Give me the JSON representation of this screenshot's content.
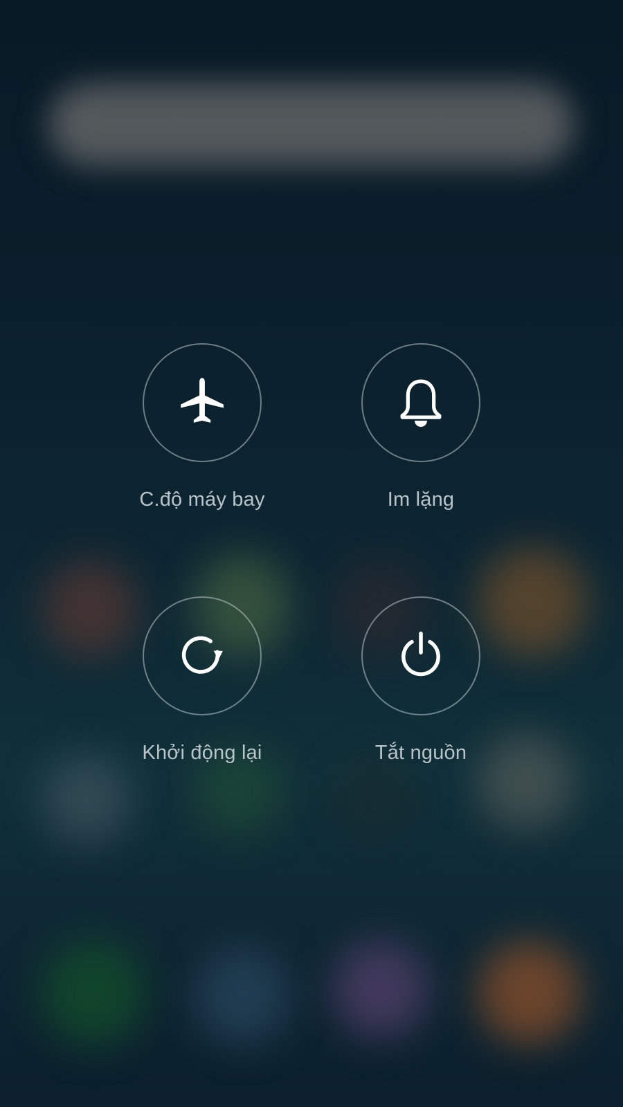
{
  "actions": [
    {
      "id": "airplane",
      "label": "C.độ máy bay",
      "icon": "airplane-icon"
    },
    {
      "id": "silent",
      "label": "Im lặng",
      "icon": "bell-icon"
    },
    {
      "id": "restart",
      "label": "Khởi động lại",
      "icon": "restart-icon"
    },
    {
      "id": "power",
      "label": "Tắt nguồn",
      "icon": "power-icon"
    }
  ],
  "colors": {
    "background": "#0a1e2b",
    "ring": "#bec8cd",
    "label": "#b9c4c8",
    "icon": "#ffffff"
  }
}
